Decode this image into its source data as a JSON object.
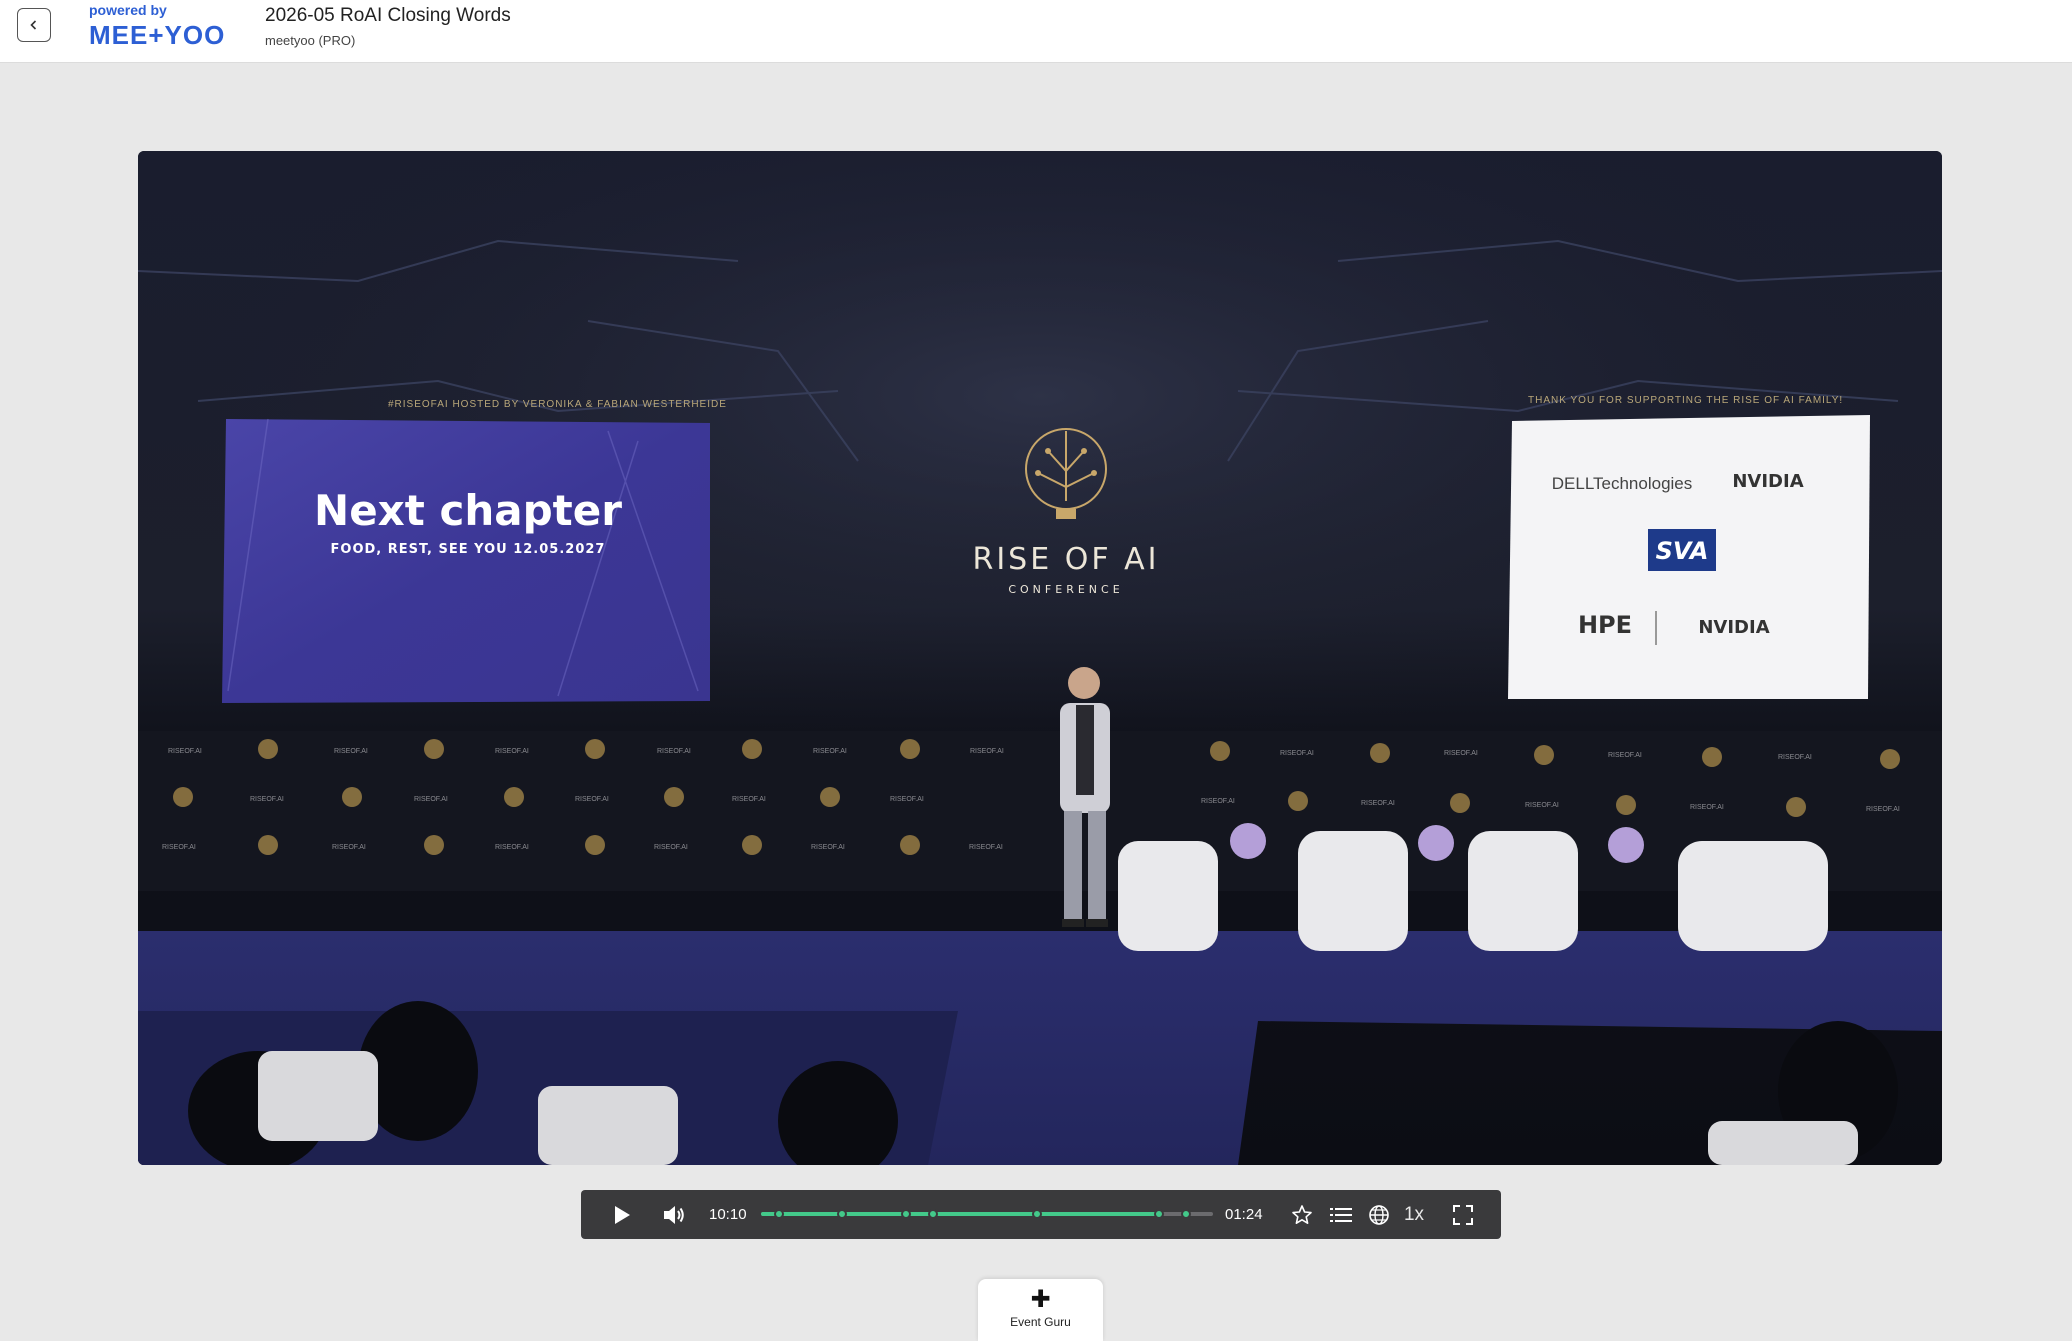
{
  "header": {
    "back_icon": "chevron-left-icon",
    "brand_powered": "powered by",
    "brand_logo": "MEE+YOO",
    "title": "2026-05 RoAI Closing Words",
    "subtitle": "meetyoo (PRO)",
    "brand_color": "#2d5fd4"
  },
  "video": {
    "left_screen_caption": "#RISEOFAI HOSTED BY VERONIKA & FABIAN WESTERHEIDE",
    "left_screen_title": "Next chapter",
    "left_screen_subtitle": "FOOD, REST, SEE YOU 12.05.2027",
    "center_logo_title": "RISE OF AI",
    "center_logo_subtitle": "CONFERENCE",
    "right_screen_caption": "THANK YOU FOR SUPPORTING THE RISE OF AI FAMILY!",
    "sponsors": [
      "DELLTechnologies",
      "NVIDIA",
      "SVA",
      "HPE",
      "NVIDIA"
    ],
    "backdrop_text": "RISEOF.AI"
  },
  "controls": {
    "play_icon": "play-icon",
    "volume_icon": "volume-icon",
    "elapsed": "10:10",
    "remaining": "01:24",
    "progress_fraction": 0.88,
    "chapter_marks": [
      0.04,
      0.18,
      0.32,
      0.38,
      0.61,
      0.88,
      0.94
    ],
    "favorite_icon": "star-icon",
    "chapters_icon": "list-icon",
    "language_icon": "globe-icon",
    "speed": "1x",
    "fullscreen_icon": "fullscreen-icon",
    "accent_color": "#43c98a"
  },
  "event_guru": {
    "icon": "sparkle-icon",
    "label": "Event Guru"
  }
}
